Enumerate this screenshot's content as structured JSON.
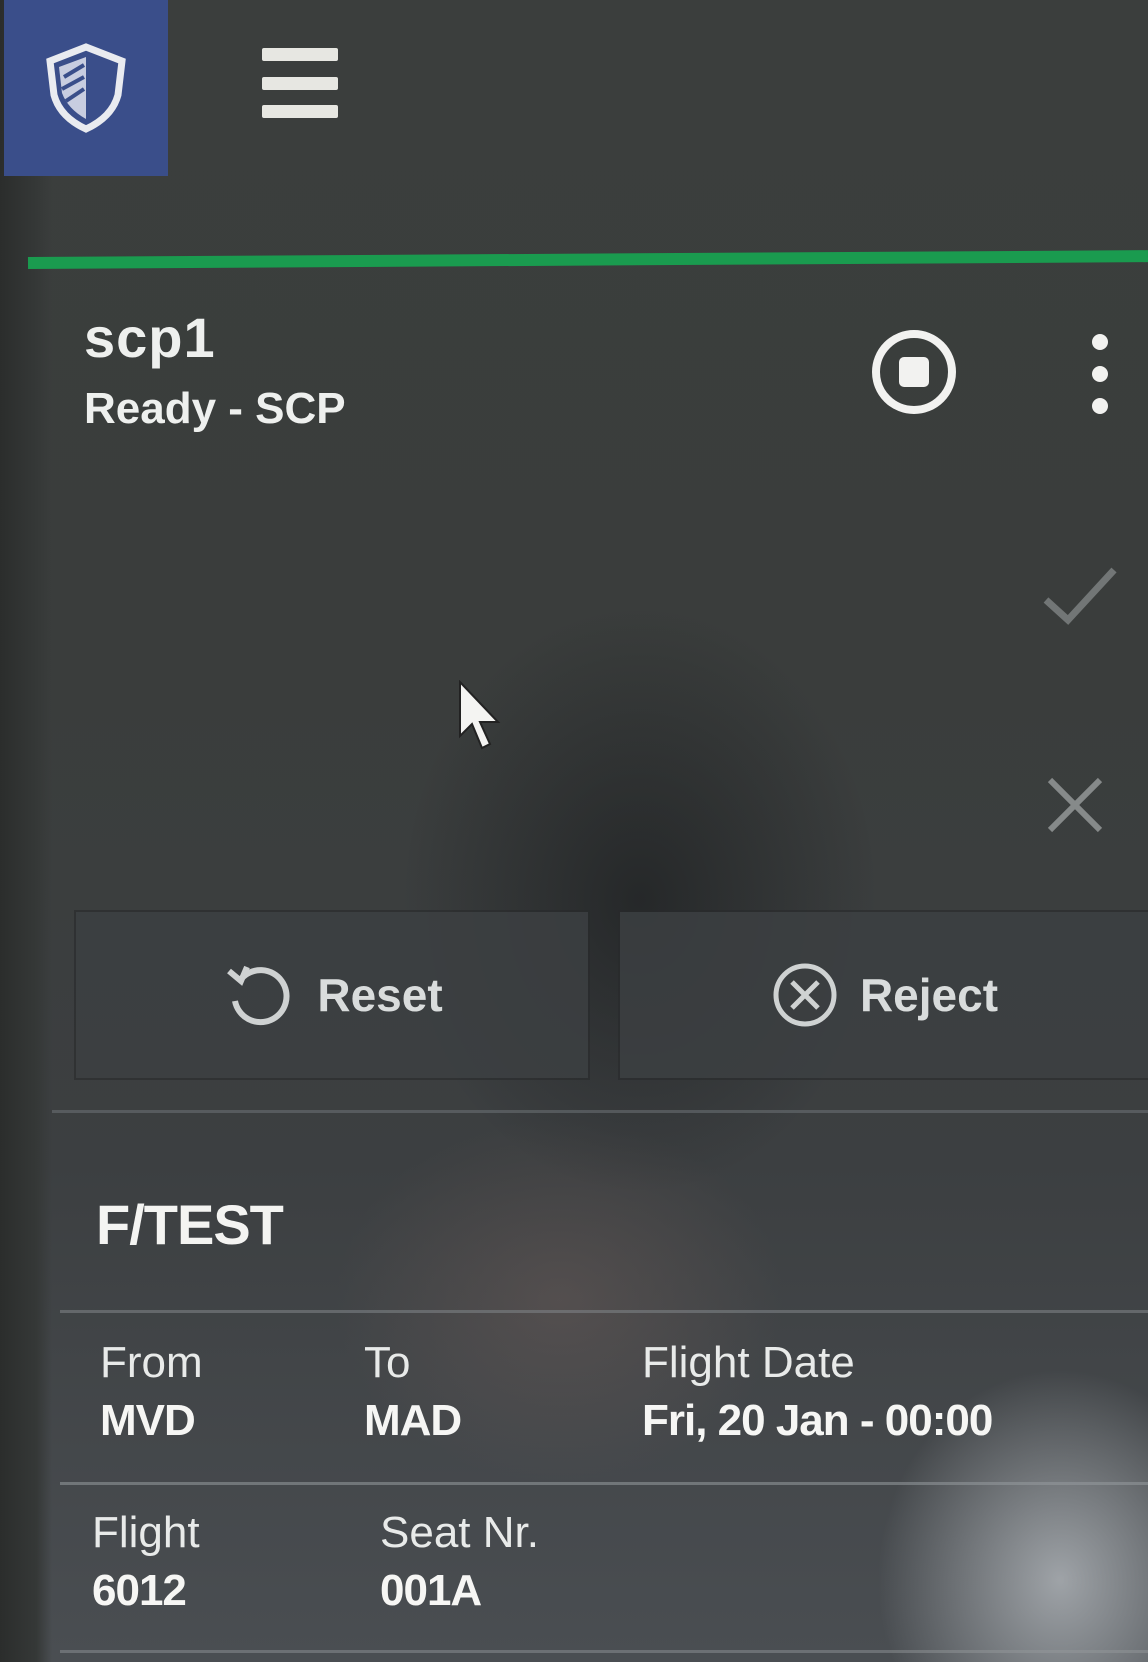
{
  "header": {
    "logo_icon": "shield-icon",
    "menu_icon": "hamburger-menu-icon",
    "logo_color": "#3a4e8a"
  },
  "status_bar": {
    "color": "#1a9b4f"
  },
  "station": {
    "name": "scp1",
    "status": "Ready - SCP",
    "stop_icon": "stop-circle-icon",
    "more_icon": "more-vertical-icon"
  },
  "side_actions": {
    "accept_icon": "check-icon",
    "cancel_icon": "close-icon"
  },
  "actions": {
    "reset_label": "Reset",
    "reset_icon": "reset-icon",
    "reject_label": "Reject",
    "reject_icon": "reject-circle-icon"
  },
  "passenger": {
    "name": "F/TEST",
    "from_label": "From",
    "from_value": "MVD",
    "to_label": "To",
    "to_value": "MAD",
    "date_label": "Flight Date",
    "date_value": "Fri, 20 Jan - 00:00",
    "flight_label": "Flight",
    "flight_value": "6012",
    "seat_label": "Seat Nr.",
    "seat_value": "001A"
  }
}
